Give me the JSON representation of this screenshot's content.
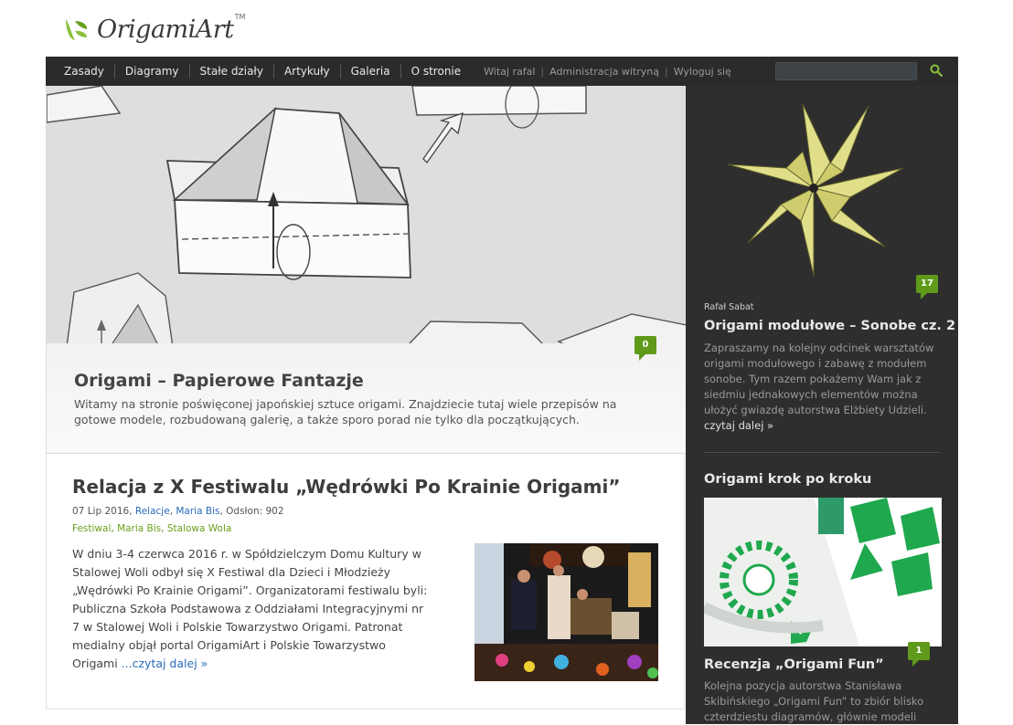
{
  "logo": {
    "text": "OrigamiArt",
    "tm": "TM"
  },
  "nav": {
    "items": [
      "Zasady",
      "Diagramy",
      "Stałe działy",
      "Artykuły",
      "Galeria",
      "O stronie"
    ],
    "welcome": "Witaj rafal",
    "admin": "Administracja witryną",
    "logout": "Wyloguj się",
    "separator": "|"
  },
  "search": {
    "placeholder": "",
    "value": ""
  },
  "hero": {
    "title": "Origami – Papierowe Fantazje",
    "description": "Witamy na stronie poświęconej japońskiej sztuce origami. Znajdziecie tutaj wiele przepisów na gotowe modele, rozbudowaną galerię, a także sporo porad nie tylko dla początkujących.",
    "comments": "0"
  },
  "article": {
    "title": "Relacja z X Festiwalu „Wędrówki Po Krainie Origami”",
    "date": "07 Lip 2016",
    "category": "Relacje",
    "author": "Maria Bis",
    "views": "Odsłon: 902",
    "tags": [
      "Festiwal",
      "Maria Bis",
      "Stalowa Wola"
    ],
    "body": "W dniu 3-4 czerwca 2016 r. w Spółdzielczym Domu Kultury w Stalowej Woli odbył się X Festiwal dla Dzieci i Młodzieży „Wędrówki Po Krainie Origami”. Organizatorami festiwalu byli: Publiczna Szkoła Podstawowa z Oddziałami Integracyjnymi nr 7 w Stalowej Woli i Polskie Towarzystwo Origami. Patronat medialny objął portal OrigamiArt i Polskie Towarzystwo Origami ",
    "read_more": "...czytaj dalej »"
  },
  "sidebar": {
    "featured": {
      "comments": "17",
      "author": "Rafał Sabat",
      "title": "Origami modułowe – Sonobe cz. 2",
      "text": "Zapraszamy na kolejny odcinek warsztatów origami modułowego i zabawę z modułem sonobe. Tym razem pokażemy Wam jak z siedmiu jednakowych elementów można ułożyć gwiazdę autorstwa Elżbiety Udzieli.",
      "read_more": "czytaj dalej »"
    },
    "section_title": "Origami krok po kroku",
    "review": {
      "comments": "1",
      "title": "Recenzja „Origami Fun”",
      "text": "Kolejna pozycja autorstwa Stanisława Skibińskiego „Origami Fun” to zbiór blisko czterdziestu diagramów, głównie modeli"
    }
  },
  "colors": {
    "accent_green": "#5f9a1a",
    "nav_bg": "#2b2b2b",
    "sidebar_bg": "#2e2e2e",
    "link_blue": "#2a6ab8"
  }
}
